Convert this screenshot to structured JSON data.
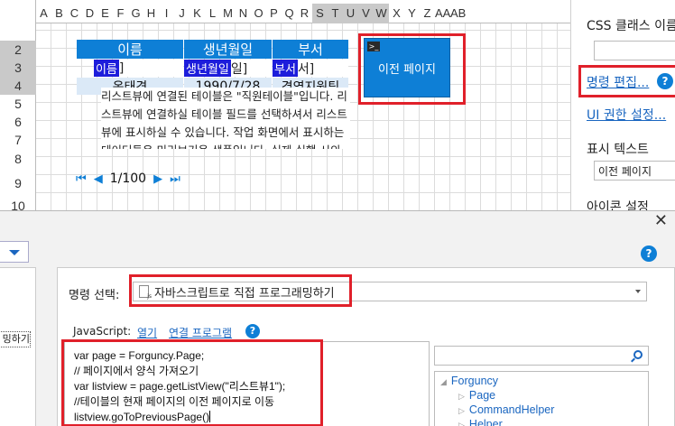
{
  "sheet": {
    "columns": [
      "A",
      "B",
      "C",
      "D",
      "E",
      "F",
      "G",
      "H",
      "I",
      "J",
      "K",
      "L",
      "M",
      "N",
      "O",
      "P",
      "Q",
      "R",
      "S",
      "T",
      "U",
      "V",
      "W",
      "X",
      "Y",
      "Z",
      "AA",
      "AB"
    ],
    "rows": [
      "2",
      "3",
      "4",
      "5",
      "6",
      "7",
      "8",
      "9",
      "10"
    ],
    "listview": {
      "headers": [
        "이름",
        "생년월일",
        "부서"
      ],
      "bindings": [
        {
          "tag": "이름",
          "suffix": "]"
        },
        {
          "tag": "생년월일",
          "suffix": "일]"
        },
        {
          "tag": "부서",
          "suffix": "서]"
        }
      ],
      "row": [
        "옥태견",
        "1990/7/28",
        "경영지원팀"
      ],
      "desc": "리스트뷰에 연결된 테이블은 \"직원테이블\"입니다.\n리스트뷰에 연결하실 테이블 필드를 선택하셔서 리스트뷰에 표시하실 수 있습니다.\n작업 화면에서 표시하는 데이터들은 미리보기용 샘플입니다. 실제 실행 시의 결과와 다를 수 있습니다.",
      "pager": {
        "first": "⏮",
        "prev": "◀",
        "page": "1/100",
        "next": "▶",
        "last": "⏭"
      }
    },
    "button": {
      "label": "이전 페이지",
      "icon_glyph": ">_"
    }
  },
  "props": {
    "css_label": "CSS 클래스 이름",
    "cmd_edit_link": "명령 편집...",
    "ui_perm_link": "UI 권한 설정...",
    "display_text_label": "표시 텍스트",
    "display_text_value": "이전 페이지",
    "icon_label": "아이콘 설정"
  },
  "dialog": {
    "close_glyph": "✕",
    "help_glyph": "?",
    "left_item": "밍하기",
    "cmd_label": "명령 선택:",
    "cmd_value": "자바스크립트로 직접 프로그래밍하기",
    "js_label": "JavaScript:",
    "js_open": "열기",
    "js_assoc": "연결 프로그램",
    "code_lines": [
      "var page = Forguncy.Page;",
      "// 페이지에서 양식 가져오기",
      "var listview = page.getListView(\"리스트뷰1\");",
      "//테이블의 현재 페이지의 이전 페이지로 이동",
      "listview.goToPreviousPage()"
    ],
    "tree": [
      {
        "label": "Forguncy",
        "expanded": true,
        "level": 0
      },
      {
        "label": "Page",
        "level": 1
      },
      {
        "label": "CommandHelper",
        "level": 1
      },
      {
        "label": "Helper",
        "level": 1
      }
    ]
  }
}
